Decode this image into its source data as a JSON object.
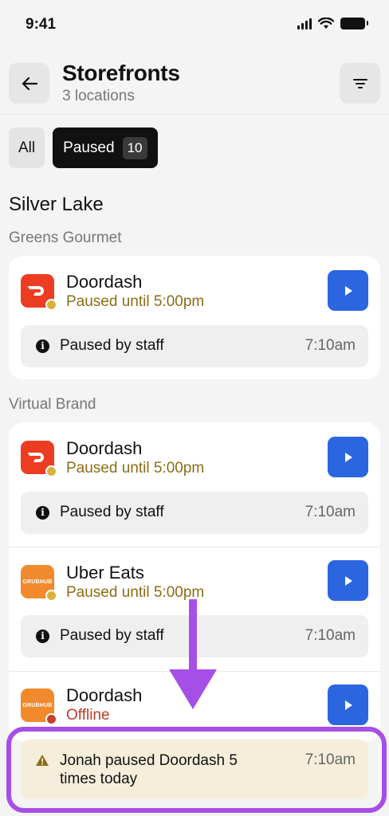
{
  "status_bar": {
    "time": "9:41"
  },
  "header": {
    "title": "Storefronts",
    "subtitle": "3 locations"
  },
  "tabs": [
    {
      "label": "All"
    },
    {
      "label": "Paused",
      "count": "10"
    }
  ],
  "section": {
    "title": "Silver Lake"
  },
  "groups": [
    {
      "label": "Greens Gourmet",
      "entries": [
        {
          "name": "Doordash",
          "status": "Paused until 5:00pm",
          "logo": "doordash-logo",
          "note": "Paused by staff",
          "note_time": "7:10am"
        }
      ]
    },
    {
      "label": "Virtual Brand",
      "entries": [
        {
          "name": "Doordash",
          "status": "Paused until 5:00pm",
          "logo": "doordash-logo",
          "note": "Paused by staff",
          "note_time": "7:10am"
        },
        {
          "name": "Uber Eats",
          "status": "Paused until 5:00pm",
          "logo": "grubhub-logo",
          "logo_text": "GRUBHUB",
          "note": "Paused by staff",
          "note_time": "7:10am"
        },
        {
          "name": "Doordash",
          "status": "Offline",
          "logo": "grubhub-logo",
          "logo_text": "GRUBHUB"
        }
      ]
    }
  ],
  "alert": {
    "text": "Jonah paused Doordash 5 times today",
    "time": "7:10am"
  },
  "colors": {
    "accent_blue": "#2b66e0",
    "paused": "#8a6d17",
    "offline": "#c0392b",
    "highlight": "#a64fe6"
  }
}
